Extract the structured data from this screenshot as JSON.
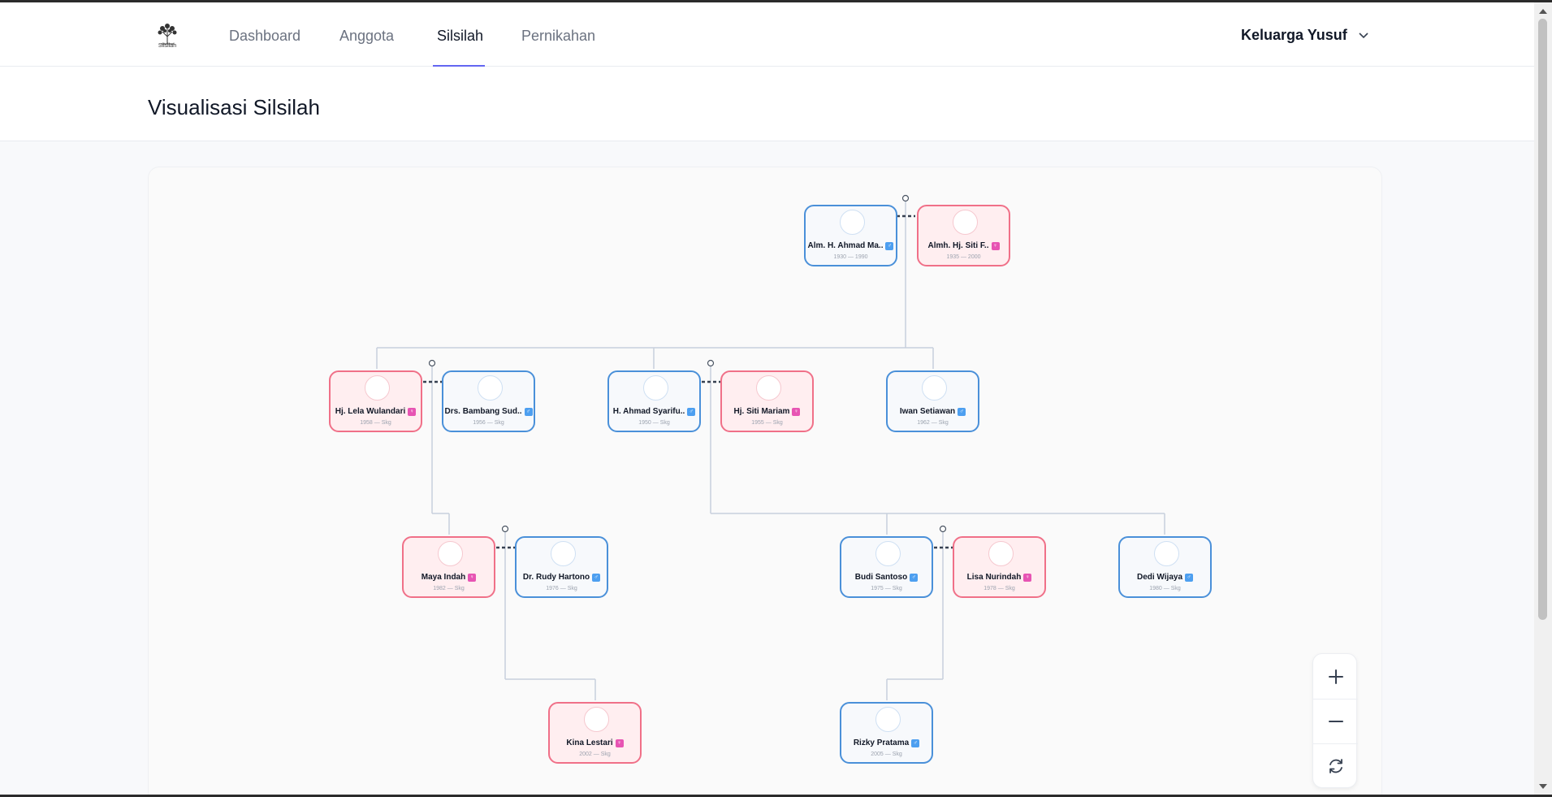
{
  "app": {
    "logo_text": "Silsilah"
  },
  "nav": {
    "items": [
      {
        "label": "Dashboard",
        "active": false
      },
      {
        "label": "Anggota",
        "active": false
      },
      {
        "label": "Silsilah",
        "active": true
      },
      {
        "label": "Pernikahan",
        "active": false
      }
    ],
    "family_selector": "Keluarga Yusuf",
    "family_selector_icon": "chevron-down-icon"
  },
  "page": {
    "title": "Visualisasi Silsilah"
  },
  "tree": {
    "members": [
      {
        "id": "ahmad-ma",
        "name": "Alm. H. Ahmad Ma..",
        "gender": "male",
        "years": "1930 — 1990"
      },
      {
        "id": "siti-f",
        "name": "Almh. Hj. Siti F..",
        "gender": "female",
        "years": "1935 — 2000"
      },
      {
        "id": "lela",
        "name": "Hj. Lela Wulandari",
        "gender": "female",
        "years": "1958 — Skg"
      },
      {
        "id": "bambang",
        "name": "Drs. Bambang Sud..",
        "gender": "male",
        "years": "1956 — Skg"
      },
      {
        "id": "ahmad-s",
        "name": "H. Ahmad Syarifu..",
        "gender": "male",
        "years": "1950 — Skg"
      },
      {
        "id": "siti-m",
        "name": "Hj. Siti Mariam",
        "gender": "female",
        "years": "1955 — Skg"
      },
      {
        "id": "iwan",
        "name": "Iwan Setiawan",
        "gender": "male",
        "years": "1962 — Skg"
      },
      {
        "id": "maya",
        "name": "Maya Indah",
        "gender": "female",
        "years": "1982 — Skg"
      },
      {
        "id": "rudy",
        "name": "Dr. Rudy Hartono",
        "gender": "male",
        "years": "1976 — Skg"
      },
      {
        "id": "budi",
        "name": "Budi Santoso",
        "gender": "male",
        "years": "1975 — Skg"
      },
      {
        "id": "lisa",
        "name": "Lisa Nurindah",
        "gender": "female",
        "years": "1978 — Skg"
      },
      {
        "id": "dedi",
        "name": "Dedi Wijaya",
        "gender": "male",
        "years": "1980 — Skg"
      },
      {
        "id": "kina",
        "name": "Kina Lestari",
        "gender": "female",
        "years": "2002 — Skg"
      },
      {
        "id": "rizky",
        "name": "Rizky Pratama",
        "gender": "male",
        "years": "2005 — Skg"
      }
    ],
    "colors": {
      "male_border": "#4a90d9",
      "female_border": "#f07088",
      "male_badge": "#4d9ff0",
      "female_badge": "#e754b3",
      "connector": "#c8d0dc",
      "marriage_dash": "#374151"
    }
  },
  "zoom_controls": {
    "zoom_in_icon": "plus-icon",
    "zoom_out_icon": "minus-icon",
    "reset_icon": "refresh-icon"
  }
}
